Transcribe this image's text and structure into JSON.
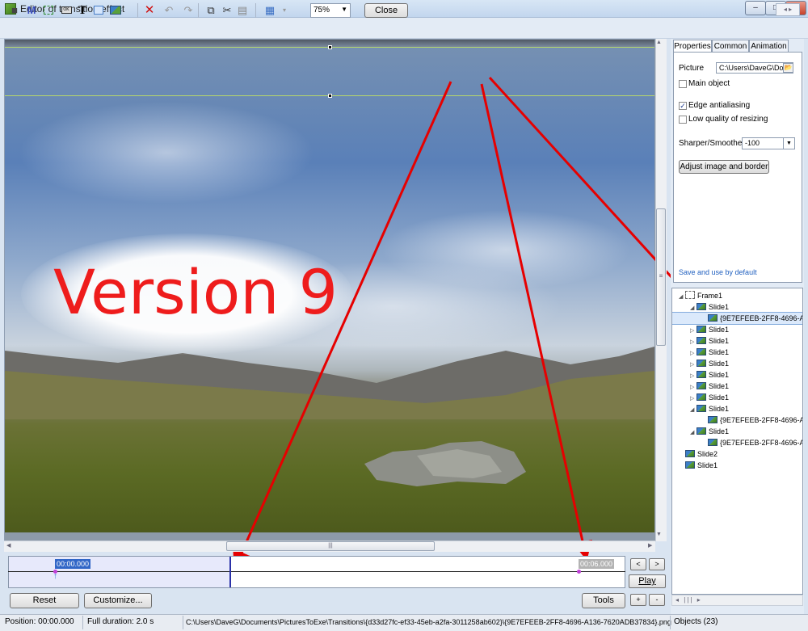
{
  "window": {
    "title": "Editor of transition effect",
    "minimize": "–",
    "maximize": "□",
    "close": "✕"
  },
  "toolbar": {
    "zoom": "75%",
    "close_label": "Close",
    "nav": "◂ ▸",
    "icons": [
      "camera-icon",
      "mask-icon",
      "frame-icon",
      "button-icon",
      "text-icon",
      "rectangle-icon",
      "image-icon",
      "delete-icon",
      "undo-icon",
      "redo-icon",
      "copy-icon",
      "cut-icon",
      "paste-icon",
      "grid-icon"
    ]
  },
  "canvas": {
    "overlay_text": "Version 9"
  },
  "timeline": {
    "start_time": "00:00.000",
    "end_time": "00:06.000"
  },
  "controls": {
    "reset": "Reset",
    "customize": "Customize...",
    "tools": "Tools",
    "play": "Play",
    "prev": "<",
    "next": ">",
    "plus": "+",
    "minus": "-"
  },
  "panel": {
    "tabs": [
      "Properties",
      "Common",
      "Animation"
    ],
    "picture_label": "Picture",
    "picture_value": "C:\\Users\\DaveG\\Do",
    "main_object": "Main object",
    "edge_antialiasing": "Edge antialiasing",
    "edge_checked": "✓",
    "low_quality": "Low quality of resizing",
    "sharper_label": "Sharper/Smoother",
    "sharper_value": "-100",
    "adjust_button": "Adjust image and border",
    "save_default": "Save and use by default"
  },
  "tree": [
    {
      "label": "Frame1",
      "depth": 0,
      "arrow": "◢",
      "kind": "frame"
    },
    {
      "label": "Slide1",
      "depth": 1,
      "arrow": "◢",
      "kind": "image"
    },
    {
      "label": "{9E7EFEEB-2FF8-4696-A136",
      "depth": 2,
      "arrow": "",
      "kind": "image",
      "selected": true
    },
    {
      "label": "Slide1",
      "depth": 1,
      "arrow": "▷",
      "kind": "image"
    },
    {
      "label": "Slide1",
      "depth": 1,
      "arrow": "▷",
      "kind": "image"
    },
    {
      "label": "Slide1",
      "depth": 1,
      "arrow": "▷",
      "kind": "image"
    },
    {
      "label": "Slide1",
      "depth": 1,
      "arrow": "▷",
      "kind": "image"
    },
    {
      "label": "Slide1",
      "depth": 1,
      "arrow": "▷",
      "kind": "image"
    },
    {
      "label": "Slide1",
      "depth": 1,
      "arrow": "▷",
      "kind": "image"
    },
    {
      "label": "Slide1",
      "depth": 1,
      "arrow": "▷",
      "kind": "image"
    },
    {
      "label": "Slide1",
      "depth": 1,
      "arrow": "◢",
      "kind": "image"
    },
    {
      "label": "{9E7EFEEB-2FF8-4696-A136",
      "depth": 2,
      "arrow": "",
      "kind": "image"
    },
    {
      "label": "Slide1",
      "depth": 1,
      "arrow": "◢",
      "kind": "image"
    },
    {
      "label": "{9E7EFEEB-2FF8-4696-A136",
      "depth": 2,
      "arrow": "",
      "kind": "image"
    },
    {
      "label": "Slide2",
      "depth": 0,
      "arrow": "",
      "kind": "image"
    },
    {
      "label": "Slide1",
      "depth": 0,
      "arrow": "",
      "kind": "image"
    }
  ],
  "tree_scroll": "◂  |||  ▸",
  "status": {
    "position": "Position:  00:00.000",
    "duration": "Full duration:  2.0 s",
    "path": "C:\\Users\\DaveG\\Documents\\PicturesToExe\\Transitions\\{d33d27fc-ef33-45eb-a2fa-3011258ab602}\\{9E7EFEEB-2FF8-4696-A136-7620ADB37834}.png",
    "objects": "Objects (23)"
  },
  "scroll": {
    "grip": "|||",
    "grip_v": "≡"
  },
  "colors": {
    "arrow": "#e60000",
    "accent": "#3166c7"
  }
}
